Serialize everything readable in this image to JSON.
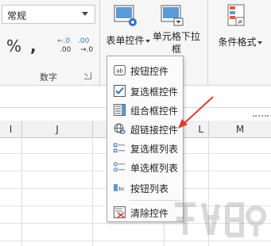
{
  "ribbon": {
    "number_format": {
      "value": "常规"
    },
    "percent_label": "%",
    "comma_label": ",",
    "increase_decimal": {
      "top": "←.0",
      "bottom": ".00"
    },
    "decrease_decimal": {
      "top": ".00",
      "bottom": "→.0"
    },
    "number_group_label": "数字",
    "form_control_label": "表单控件",
    "cell_dropdown_label_line1": "单元格下拉",
    "cell_dropdown_label_line2": "框",
    "conditional_format_label": "条件格式"
  },
  "columns": [
    "I",
    "J",
    "K",
    "L",
    "M"
  ],
  "menu": {
    "items": [
      {
        "label": "按钮控件",
        "icon": "button-control-icon"
      },
      {
        "label": "复选框控件",
        "icon": "checkbox-control-icon"
      },
      {
        "label": "组合框控件",
        "icon": "combobox-control-icon"
      },
      {
        "label": "超链接控件",
        "icon": "hyperlink-control-icon"
      },
      {
        "label": "复选框列表",
        "icon": "checkbox-list-icon"
      },
      {
        "label": "单选框列表",
        "icon": "radio-list-icon"
      },
      {
        "label": "按钮列表",
        "icon": "button-list-icon"
      },
      {
        "label": "清除控件",
        "icon": "clear-controls-icon"
      }
    ]
  },
  "colors": {
    "accent_blue": "#2e6fc4",
    "arrow_red": "#e03a2c",
    "ribbon_bg": "#f6f6f6"
  }
}
